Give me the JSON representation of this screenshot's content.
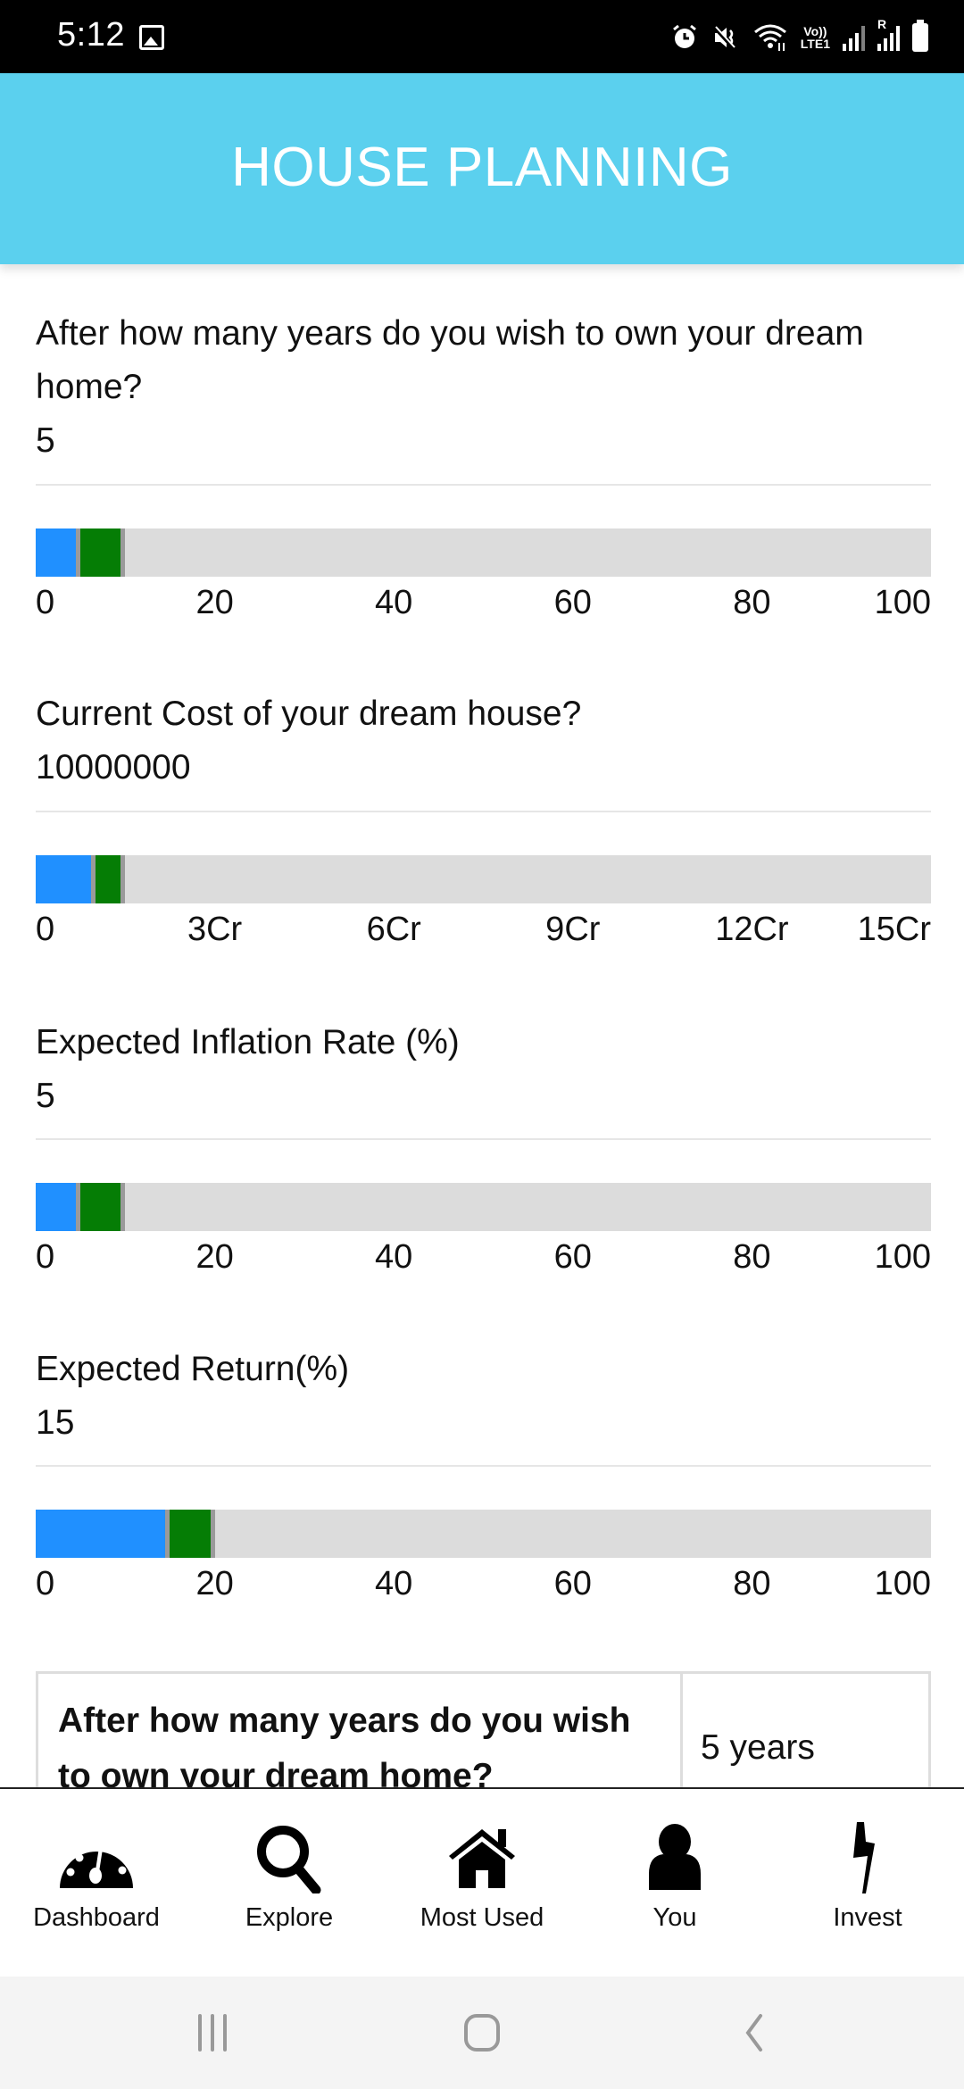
{
  "status_bar": {
    "time": "5:12",
    "left_icons": [
      "gallery-notification-icon"
    ],
    "right_icons": [
      "alarm-icon",
      "mute-icon",
      "wifi-icon",
      "volte-lte1-icon",
      "signal-icon",
      "roaming-signal-icon",
      "battery-icon"
    ],
    "volte_label": "Vo))",
    "lte_label": "LTE1",
    "roaming_label": "R"
  },
  "header": {
    "title": "HOUSE PLANNING",
    "background_color": "#5bd0ee"
  },
  "colors": {
    "primary_segment": "#2090ff",
    "secondary_segment": "#057d05",
    "track": "#dcdcdc"
  },
  "questions": [
    {
      "label": "After how many years do you wish to own your dream home?",
      "value": "5",
      "slider": {
        "min": 0,
        "max": 100,
        "blue_end": 5,
        "green_end": 10
      },
      "ticks": [
        "0",
        "20",
        "40",
        "60",
        "80",
        "100"
      ]
    },
    {
      "label": "Current Cost of your dream house?",
      "value": "10000000",
      "slider": {
        "min": 0,
        "max": 15,
        "blue_end": 1,
        "green_end": 1.5
      },
      "ticks": [
        "0",
        "3Cr",
        "6Cr",
        "9Cr",
        "12Cr",
        "15Cr"
      ]
    },
    {
      "label": "Expected Inflation Rate (%)",
      "value": "5",
      "slider": {
        "min": 0,
        "max": 100,
        "blue_end": 5,
        "green_end": 10
      },
      "ticks": [
        "0",
        "20",
        "40",
        "60",
        "80",
        "100"
      ]
    },
    {
      "label": "Expected Return(%)",
      "value": "15",
      "slider": {
        "min": 0,
        "max": 100,
        "blue_end": 15,
        "green_end": 20
      },
      "ticks": [
        "0",
        "20",
        "40",
        "60",
        "80",
        "100"
      ]
    }
  ],
  "summary": {
    "rows": [
      {
        "question": "After how many years do you wish to own your dream home?",
        "answer": "5 years"
      }
    ]
  },
  "bottom_nav": {
    "items": [
      {
        "label": "Dashboard",
        "icon": "dashboard-gauge-icon"
      },
      {
        "label": "Explore",
        "icon": "search-icon"
      },
      {
        "label": "Most Used",
        "icon": "home-icon"
      },
      {
        "label": "You",
        "icon": "user-icon"
      },
      {
        "label": "Invest",
        "icon": "lightning-icon"
      }
    ]
  },
  "system_nav": {
    "buttons": [
      "recents",
      "home",
      "back"
    ]
  }
}
